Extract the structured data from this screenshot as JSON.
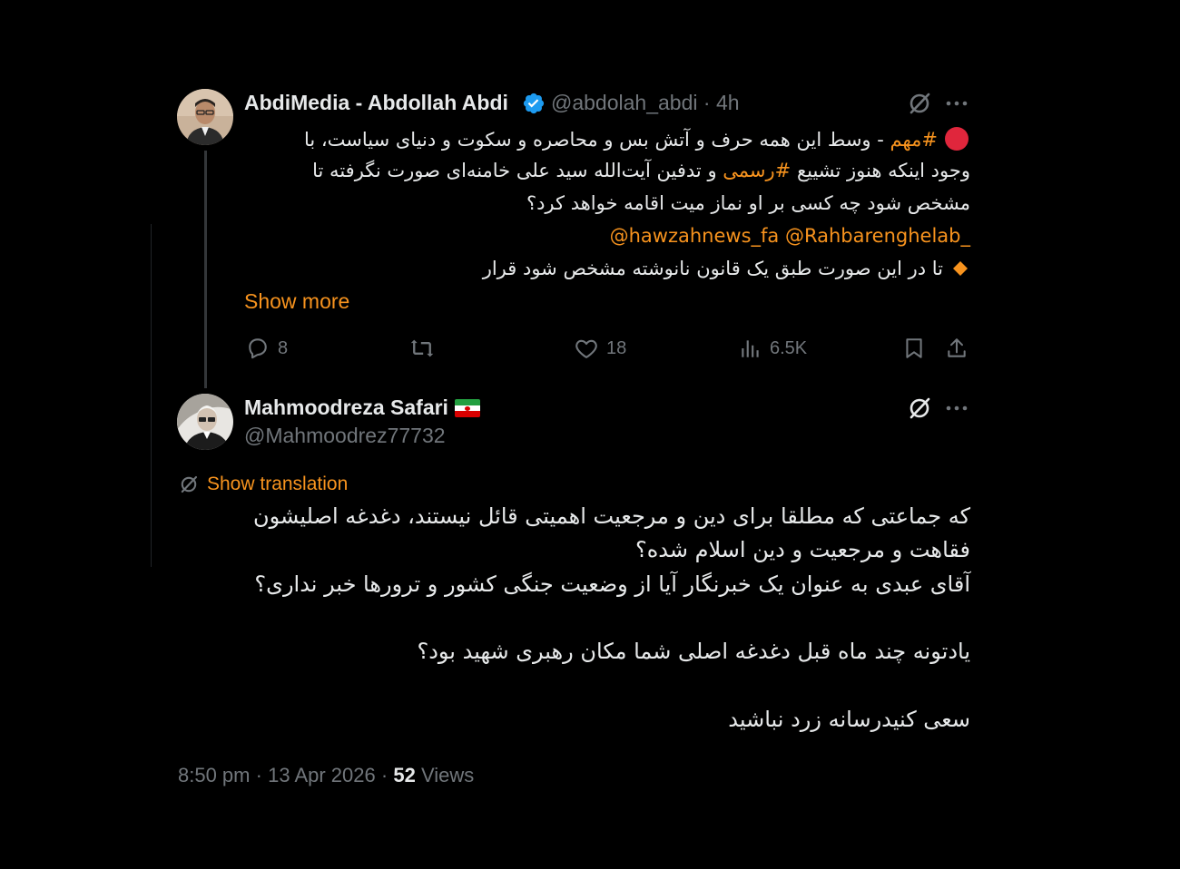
{
  "tweet": {
    "author_name": "AbdiMedia - Abdollah Abdi",
    "handle": "@abdolah_abdi",
    "separator": "·",
    "time": "4h",
    "icons": [
      "red-circle-icon",
      "orange-diamond-icon",
      "verified-badge-icon",
      "grok-icon",
      "more-icon"
    ],
    "line1_plain": " - وسط این همه حرف و آتش بس و محاصره و سکوت و دنیای سیاست، با",
    "line1_hashtag": "#مهم",
    "line2_part1": "وجود اینکه هنوز تشییع ",
    "line2_hashtag": "#رسمی",
    "line2_part2": " و تدفین آیت‌الله سید علی خامنه‌ای صورت نگرفته تا",
    "line3": "مشخص شود چه کسی بر او نماز میت اقامه خواهد کرد؟",
    "mention1": "@Rahbarenghelab_",
    "mention2": "@hawzahnews_fa",
    "line5": "تا در این صورت طبق یک قانون نانوشته مشخص شود قرار",
    "show_more": "Show more",
    "replies": "8",
    "likes": "18",
    "views": "6.5K"
  },
  "reply": {
    "author_name": "Mahmoodreza Safari",
    "handle": "@Mahmoodrez77732",
    "show_translation": "Show translation",
    "lines": [
      "که جماعتی که مطلقا برای دین و مرجعیت اهمیتی قائل نیستند، دغدغه اصلیشون",
      "فقاهت و مرجعیت و دین اسلام شده؟",
      "آقای عبدی به عنوان یک خبرنگار آیا از وضعیت جنگی کشور و ترورها خبر نداری؟",
      "یادتونه چند ماه قبل دغدغه اصلی شما مکان رهبری شهید بود؟",
      "سعی کنیدرسانه زرد نباشید"
    ],
    "time": "8:50 pm",
    "date": "13 Apr 2026",
    "views_count": "52",
    "views_label": "Views",
    "sep": "·"
  },
  "colors": {
    "background": "#000000",
    "text": "#e7e9ea",
    "muted": "#71767b",
    "accent": "#f7931e",
    "verified": "#1d9bf0"
  }
}
